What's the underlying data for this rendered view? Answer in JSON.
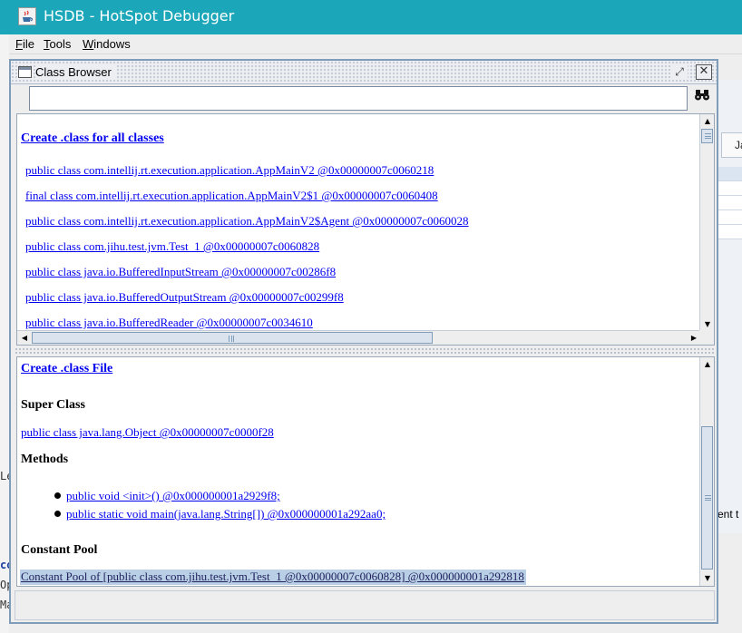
{
  "window": {
    "title": "HSDB - HotSpot Debugger",
    "accent": "#1ba7b9"
  },
  "menubar": {
    "items": [
      "File",
      "Tools",
      "Windows"
    ]
  },
  "background_right": {
    "tab_label": "Ja",
    "partial_text": "ent t"
  },
  "background_left": {
    "fragments": [
      "Le",
      "co",
      "Op",
      "Ma"
    ]
  },
  "class_browser": {
    "title": "Class Browser",
    "search": {
      "value": "",
      "placeholder": ""
    },
    "top_pane": {
      "create_all_link": "Create .class for all classes",
      "classes": [
        "public class com.intellij.rt.execution.application.AppMainV2 @0x00000007c0060218",
        "final class com.intellij.rt.execution.application.AppMainV2$1 @0x00000007c0060408",
        "public class com.intellij.rt.execution.application.AppMainV2$Agent @0x00000007c0060028",
        "public class com.jihu.test.jvm.Test_1 @0x00000007c0060828",
        "public class java.io.BufferedInputStream @0x00000007c00286f8",
        "public class java.io.BufferedOutputStream @0x00000007c00299f8",
        "public class java.io.BufferedReader @0x00000007c0034610"
      ]
    },
    "bottom_pane": {
      "create_file_link": "Create .class File",
      "super_class_heading": "Super Class",
      "super_class": "public class java.lang.Object @0x00000007c0000f28",
      "methods_heading": "Methods",
      "methods": [
        "public void <init>() @0x000000001a2929f8;",
        "public static void main(java.lang.String[]) @0x000000001a292aa0;"
      ],
      "constant_pool_heading": "Constant Pool",
      "constant_pool_link": "Constant Pool of [public class com.jihu.test.jvm.Test_1 @0x00000007c0060828] @0x000000001a292818"
    }
  }
}
